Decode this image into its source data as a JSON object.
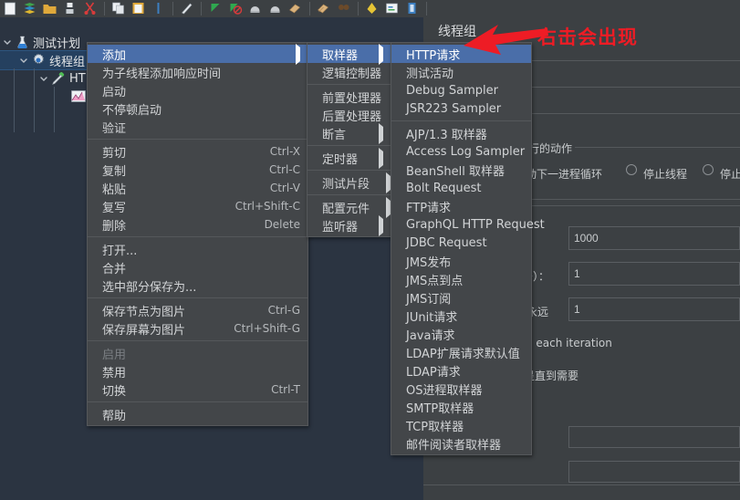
{
  "app": {
    "theme_accent": "#4a6ea9",
    "menu_bg": "#434649",
    "panel_bg": "#3c4043",
    "tree_bg": "#2b3441",
    "annotation_color": "#ee1c25"
  },
  "toolbar": {
    "items": [
      {
        "name": "new-icon",
        "label": "新建"
      },
      {
        "name": "templates-icon",
        "label": "模板"
      },
      {
        "name": "open-icon",
        "label": "打开"
      },
      {
        "name": "save-icon",
        "label": "保存"
      },
      {
        "name": "cut-icon",
        "label": "剪切"
      },
      {
        "name": "copy-icon",
        "label": "复制"
      },
      {
        "name": "paste-icon",
        "label": "粘贴"
      },
      {
        "name": "expand-icon",
        "label": "展开"
      },
      {
        "name": "toggle-icon",
        "label": "切换"
      },
      {
        "name": "start-icon",
        "label": "启动"
      },
      {
        "name": "start-no-pause-icon",
        "label": "不停顿启动"
      },
      {
        "name": "stop-icon",
        "label": "停止"
      },
      {
        "name": "shutdown-icon",
        "label": "关闭"
      },
      {
        "name": "clear-icon",
        "label": "清除"
      },
      {
        "name": "clear-all-icon",
        "label": "清除全部"
      },
      {
        "name": "search-icon",
        "label": "查找"
      },
      {
        "name": "search-reset-icon",
        "label": "重置查找"
      },
      {
        "name": "function-helper-icon",
        "label": "函数助手"
      },
      {
        "name": "help-icon",
        "label": "帮助"
      }
    ]
  },
  "tree": {
    "nodes": [
      {
        "name": "test-plan",
        "label": "测试计划",
        "icon": "flask-icon",
        "expanded": true,
        "selected": false
      },
      {
        "name": "thread-group",
        "label": "线程组",
        "icon": "gear-icon",
        "expanded": true,
        "selected": true
      },
      {
        "name": "http-request",
        "label": "HT",
        "icon": "pipette-icon",
        "expanded": true,
        "selected": false
      },
      {
        "name": "graph-results",
        "label": "",
        "icon": "graph-icon",
        "expanded": false,
        "selected": false
      }
    ]
  },
  "right_panel": {
    "title": "线程组",
    "action_group_title": "行的动作",
    "action_options": [
      {
        "label": "动下一进程循环",
        "selected": true
      },
      {
        "label": "停止线程",
        "selected": false
      },
      {
        "label": "停止",
        "selected": false
      }
    ],
    "fields": [
      {
        "name": "thread-count-field",
        "label": "",
        "value": "1000"
      },
      {
        "name": "ramp-up-field",
        "label": "少）：",
        "value": "1"
      },
      {
        "name": "loop-count-field",
        "label": "永远",
        "value": "1"
      },
      {
        "name": "duration-field",
        "label": "",
        "value": ""
      },
      {
        "name": "startup-delay-field",
        "label": "",
        "value": ""
      }
    ],
    "checkbox_labels": [
      "n each iteration",
      "呈直到需要"
    ]
  },
  "context_menu": {
    "items": [
      {
        "label": "添加",
        "accel": "",
        "submenu": true,
        "selected": true,
        "disabled": false
      },
      {
        "label": "为子线程添加响应时间",
        "accel": "",
        "submenu": false,
        "selected": false,
        "disabled": false
      },
      {
        "label": "启动",
        "accel": "",
        "submenu": false,
        "selected": false,
        "disabled": false
      },
      {
        "label": "不停顿启动",
        "accel": "",
        "submenu": false,
        "selected": false,
        "disabled": false
      },
      {
        "label": "验证",
        "accel": "",
        "submenu": false,
        "selected": false,
        "disabled": false
      },
      {
        "separator": true
      },
      {
        "label": "剪切",
        "accel": "Ctrl-X",
        "submenu": false,
        "selected": false,
        "disabled": false
      },
      {
        "label": "复制",
        "accel": "Ctrl-C",
        "submenu": false,
        "selected": false,
        "disabled": false
      },
      {
        "label": "粘贴",
        "accel": "Ctrl-V",
        "submenu": false,
        "selected": false,
        "disabled": false
      },
      {
        "label": "复写",
        "accel": "Ctrl+Shift-C",
        "submenu": false,
        "selected": false,
        "disabled": false
      },
      {
        "label": "删除",
        "accel": "Delete",
        "submenu": false,
        "selected": false,
        "disabled": false
      },
      {
        "separator": true
      },
      {
        "label": "打开...",
        "accel": "",
        "submenu": false,
        "selected": false,
        "disabled": false
      },
      {
        "label": "合并",
        "accel": "",
        "submenu": false,
        "selected": false,
        "disabled": false
      },
      {
        "label": "选中部分保存为...",
        "accel": "",
        "submenu": false,
        "selected": false,
        "disabled": false
      },
      {
        "separator": true
      },
      {
        "label": "保存节点为图片",
        "accel": "Ctrl-G",
        "submenu": false,
        "selected": false,
        "disabled": false
      },
      {
        "label": "保存屏幕为图片",
        "accel": "Ctrl+Shift-G",
        "submenu": false,
        "selected": false,
        "disabled": false
      },
      {
        "separator": true
      },
      {
        "label": "启用",
        "accel": "",
        "submenu": false,
        "selected": false,
        "disabled": true
      },
      {
        "label": "禁用",
        "accel": "",
        "submenu": false,
        "selected": false,
        "disabled": false
      },
      {
        "label": "切换",
        "accel": "Ctrl-T",
        "submenu": false,
        "selected": false,
        "disabled": false
      },
      {
        "separator": true
      },
      {
        "label": "帮助",
        "accel": "",
        "submenu": false,
        "selected": false,
        "disabled": false
      }
    ]
  },
  "add_submenu": {
    "items": [
      {
        "label": "取样器",
        "submenu": true,
        "selected": true
      },
      {
        "label": "逻辑控制器",
        "submenu": true,
        "selected": false
      },
      {
        "separator": true
      },
      {
        "label": "前置处理器",
        "submenu": true,
        "selected": false
      },
      {
        "label": "后置处理器",
        "submenu": true,
        "selected": false
      },
      {
        "label": "断言",
        "submenu": true,
        "selected": false
      },
      {
        "separator": true
      },
      {
        "label": "定时器",
        "submenu": true,
        "selected": false
      },
      {
        "separator": true
      },
      {
        "label": "测试片段",
        "submenu": true,
        "selected": false
      },
      {
        "separator": true
      },
      {
        "label": "配置元件",
        "submenu": true,
        "selected": false
      },
      {
        "label": "监听器",
        "submenu": true,
        "selected": false
      }
    ]
  },
  "sampler_submenu": {
    "items": [
      {
        "label": "HTTP请求",
        "selected": true
      },
      {
        "label": "测试活动",
        "selected": false
      },
      {
        "label": "Debug Sampler",
        "selected": false
      },
      {
        "label": "JSR223 Sampler",
        "selected": false
      },
      {
        "separator": true
      },
      {
        "label": "AJP/1.3 取样器",
        "selected": false
      },
      {
        "label": "Access Log Sampler",
        "selected": false
      },
      {
        "label": "BeanShell 取样器",
        "selected": false
      },
      {
        "label": "Bolt Request",
        "selected": false
      },
      {
        "label": "FTP请求",
        "selected": false
      },
      {
        "label": "GraphQL HTTP Request",
        "selected": false
      },
      {
        "label": "JDBC Request",
        "selected": false
      },
      {
        "label": "JMS发布",
        "selected": false
      },
      {
        "label": "JMS点到点",
        "selected": false
      },
      {
        "label": "JMS订阅",
        "selected": false
      },
      {
        "label": "JUnit请求",
        "selected": false
      },
      {
        "label": "Java请求",
        "selected": false
      },
      {
        "label": "LDAP扩展请求默认值",
        "selected": false
      },
      {
        "label": "LDAP请求",
        "selected": false
      },
      {
        "label": "OS进程取样器",
        "selected": false
      },
      {
        "label": "SMTP取样器",
        "selected": false
      },
      {
        "label": "TCP取样器",
        "selected": false
      },
      {
        "label": "邮件阅读者取样器",
        "selected": false
      }
    ]
  },
  "annotation": {
    "text": "右击会出现",
    "arrow": "arrow-pointing-left-down"
  }
}
